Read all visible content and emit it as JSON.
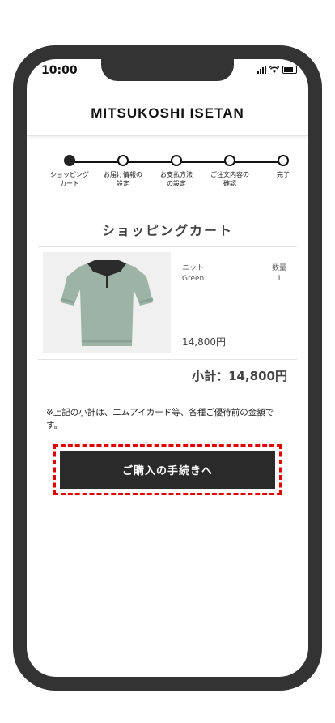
{
  "status_bar": {
    "time": "10:00"
  },
  "header": {
    "logo": "MITSUKOSHI ISETAN"
  },
  "stepper": {
    "steps": [
      {
        "label": "ショッピング\nカート",
        "active": true
      },
      {
        "label": "お届け情報の\n設定",
        "active": false
      },
      {
        "label": "お支払方法\nの設定",
        "active": false
      },
      {
        "label": "ご注文内容の\n確認",
        "active": false
      },
      {
        "label": "完了",
        "active": false
      }
    ]
  },
  "cart": {
    "title": "ショッピングカート",
    "item": {
      "name": "ニット",
      "color": "Green",
      "quantity_label": "数量",
      "quantity": "1",
      "price": "14,800円",
      "image_icon": "knit-polo-shirt-image"
    },
    "subtotal": "小計：14,800円",
    "note": "※上記の小計は、エムアイカード等、各種ご優待前の金額です。",
    "checkout_button": "ご購入の手続きへ"
  },
  "colors": {
    "frame": "#333333",
    "button": "#2a2a2a",
    "highlight": "#e00000",
    "shirt_body": "#9db3a6",
    "shirt_collar": "#2b2b2b"
  }
}
